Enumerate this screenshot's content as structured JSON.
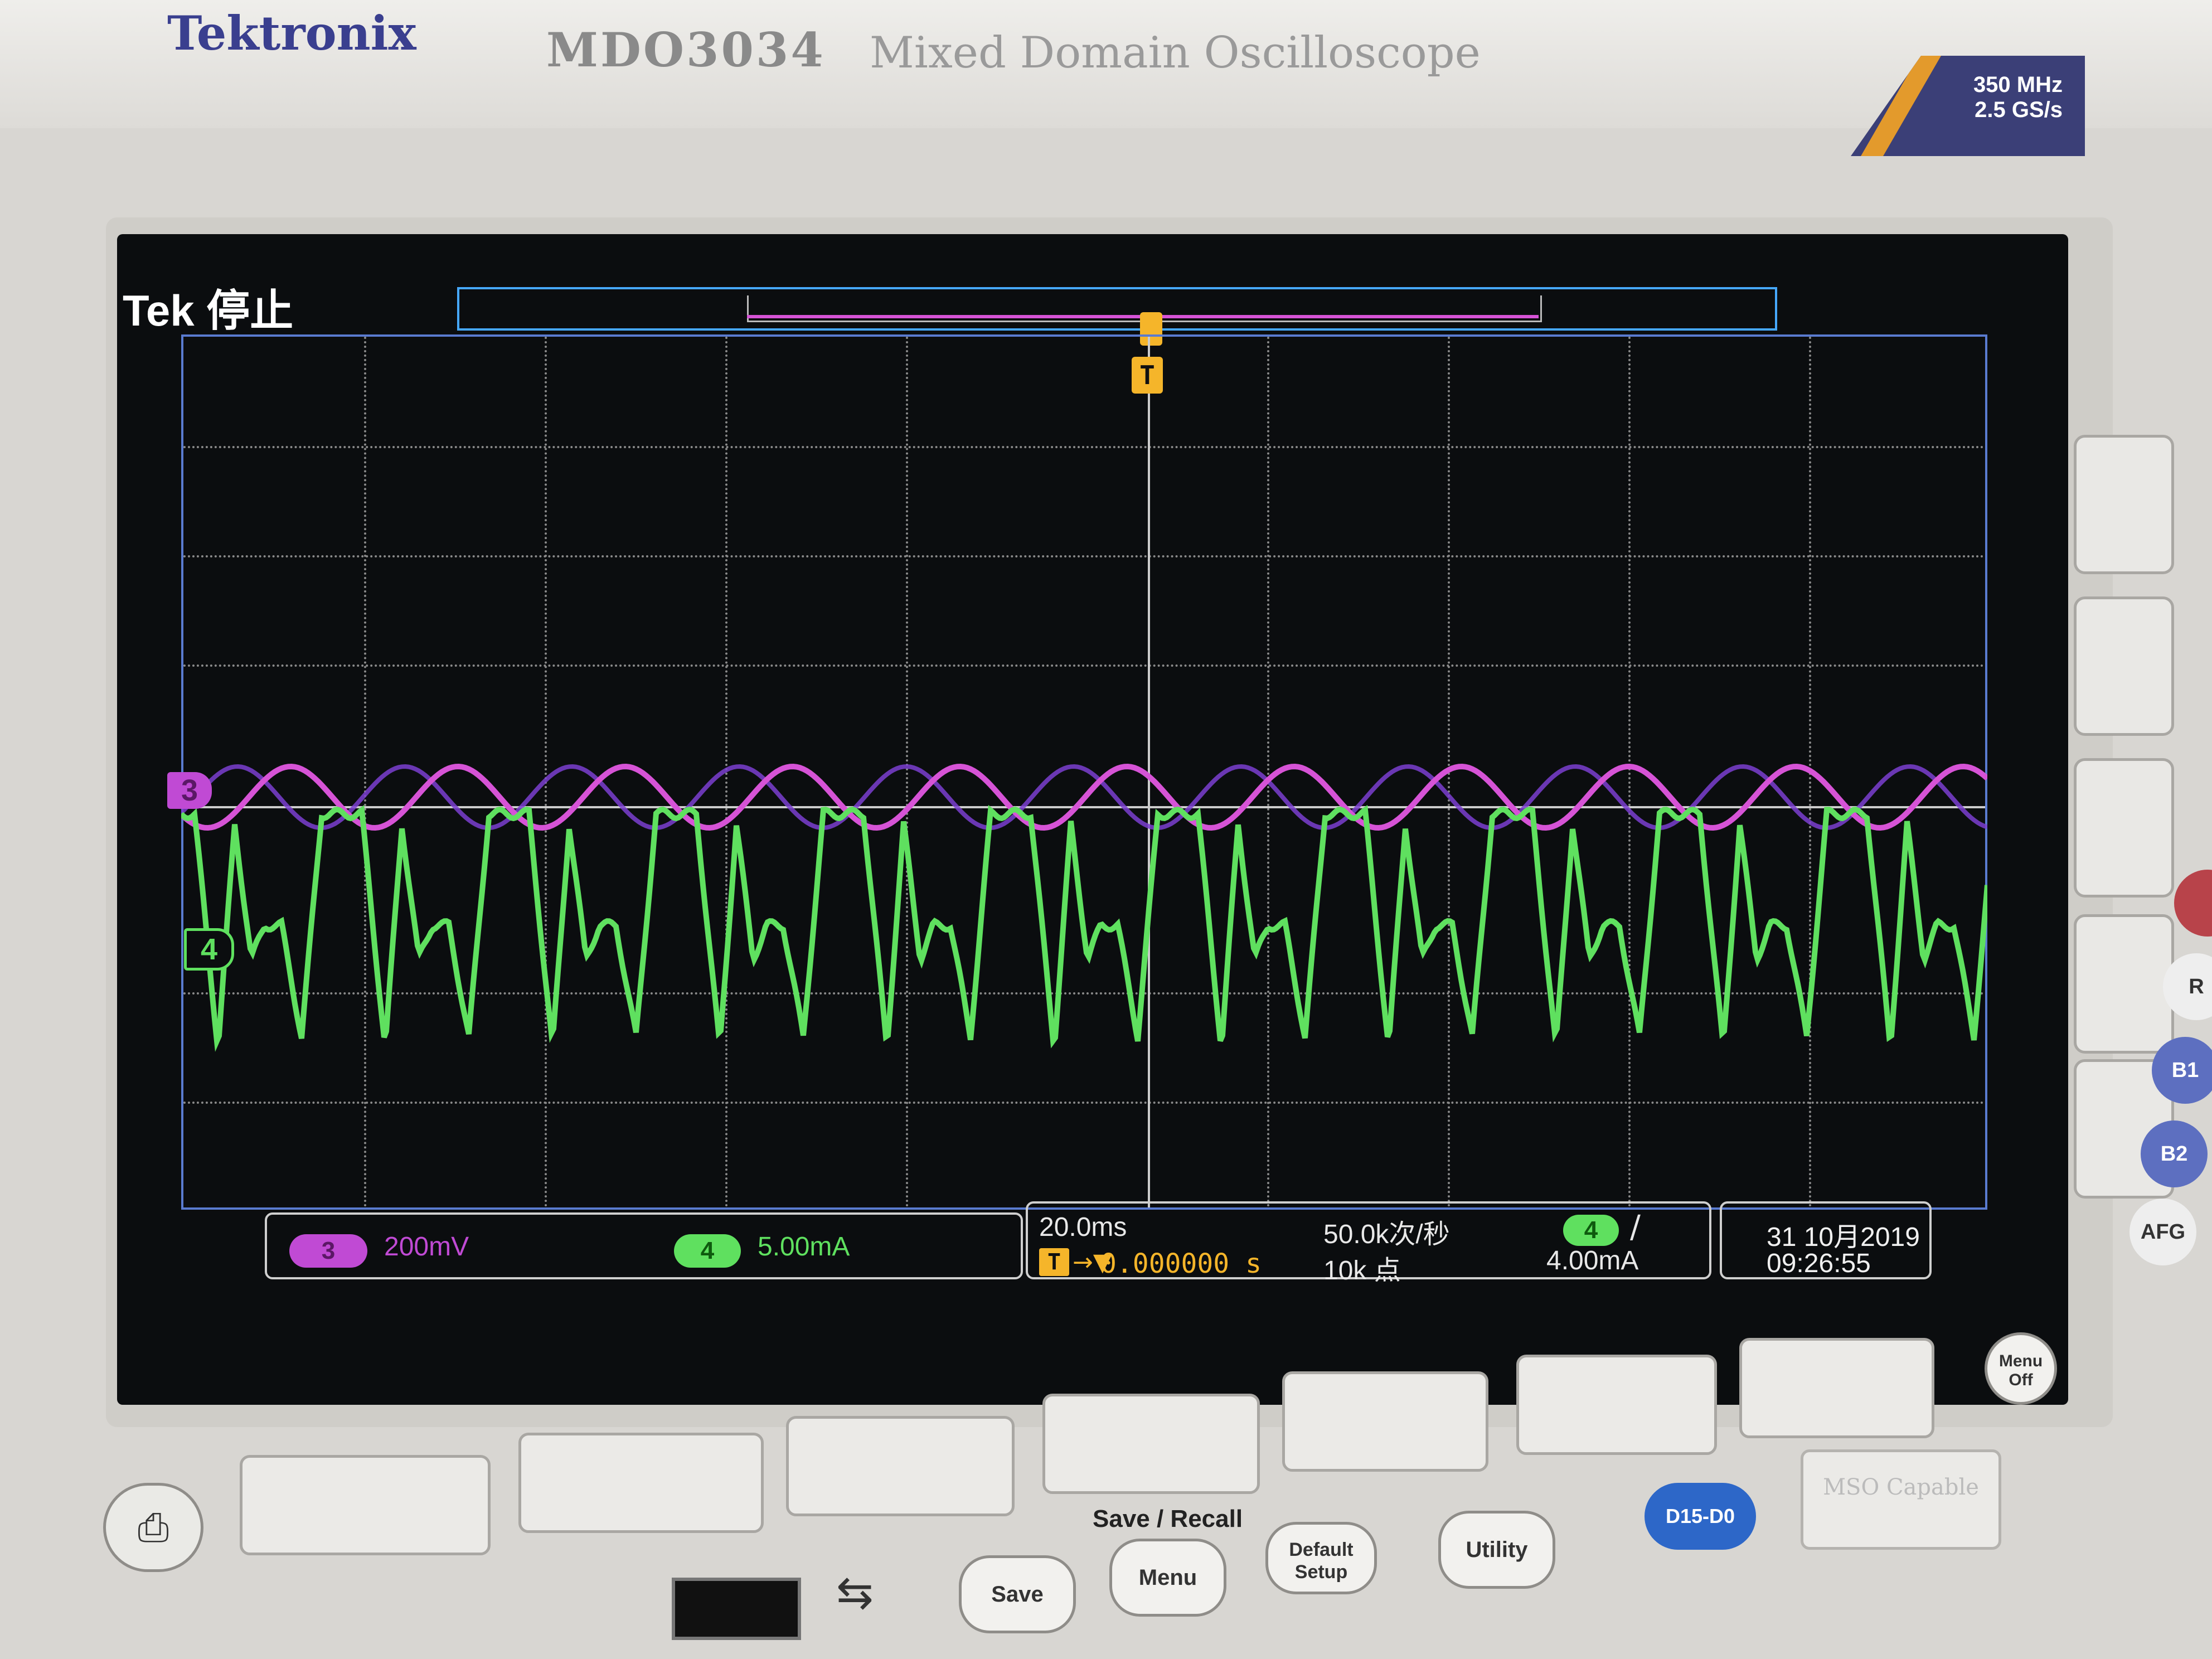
{
  "header": {
    "brand": "Tektronix",
    "model": "MDO3034",
    "description": "Mixed Domain Oscilloscope",
    "spec_bandwidth": "350 MHz",
    "spec_sample_rate": "2.5 GS/s"
  },
  "screen": {
    "status_label": "Tek 停止",
    "trigger_marker": "T",
    "ch3_marker": "3",
    "ch4_marker": "4"
  },
  "readout": {
    "ch3_label": "3",
    "ch3_scale": "200mV",
    "ch4_label": "4",
    "ch4_scale": "5.00mA",
    "timebase": "20.0ms",
    "trigger_position_icon": "T",
    "trigger_position_arrow": "→▼",
    "trigger_position": "0.000000 s",
    "sample_rate": "50.0k次/秒",
    "record_length": "10k 点",
    "trigger_channel": "4",
    "trigger_slope_icon": "rising-edge-icon",
    "trigger_slope_glyph": "/",
    "trigger_level": "4.00mA",
    "date": "31 10月2019",
    "time": "09:26:55"
  },
  "buttons": {
    "save_recall_label": "Save / Recall",
    "save": "Save",
    "menu": "Menu",
    "default_setup": "Default Setup",
    "utility": "Utility",
    "d15_d0": "D15-D0",
    "mso_capable": "MSO Capable",
    "menu_off": "Menu Off",
    "b1": "B1",
    "b2": "B2",
    "afg": "AFG",
    "r": "R"
  },
  "colors": {
    "ch3": "#c04ad4",
    "ch4": "#5fe05f",
    "trigger": "#f5b52a",
    "graticule_border": "#5a7bd0"
  }
}
